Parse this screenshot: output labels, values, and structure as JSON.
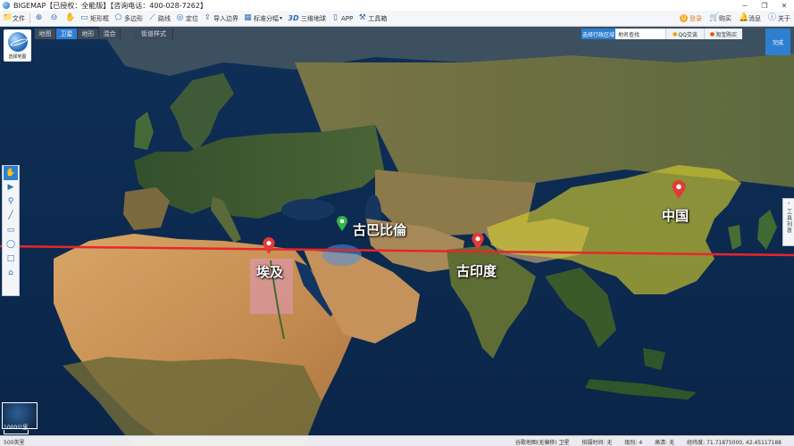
{
  "window": {
    "title": "BIGEMAP【已授权：全能版】【咨询电话：400-028-7262】",
    "controls": [
      "─",
      "❐",
      "✕"
    ]
  },
  "toolbar": {
    "items": [
      {
        "label": "文件",
        "icon": "folder-icon",
        "glyph": "📁"
      },
      {
        "label": "",
        "icon": "zoom-in-icon",
        "glyph": "⊕"
      },
      {
        "label": "",
        "icon": "zoom-out-icon",
        "glyph": "⊖"
      },
      {
        "label": "",
        "icon": "pan-hand-icon",
        "glyph": "✋"
      },
      {
        "label": "矩形框",
        "icon": "rectangle-icon",
        "glyph": "▭"
      },
      {
        "label": "多边形",
        "icon": "polygon-icon",
        "glyph": "⬠"
      },
      {
        "label": "路线",
        "icon": "route-icon",
        "glyph": "⟋"
      },
      {
        "label": "定位",
        "icon": "locate-icon",
        "glyph": "◎"
      },
      {
        "label": "导入边界",
        "icon": "import-boundary-icon",
        "glyph": "⇪"
      },
      {
        "label": "标准分幅",
        "icon": "grid-icon",
        "glyph": "▦"
      },
      {
        "label": "三维地球",
        "icon": "3d-globe-icon",
        "glyph": "3D"
      },
      {
        "label": "APP",
        "icon": "app-icon",
        "glyph": "▯"
      },
      {
        "label": "工具箱",
        "icon": "toolbox-icon",
        "glyph": "⚒"
      }
    ],
    "right": [
      {
        "label": "登录",
        "icon": "user-icon"
      },
      {
        "label": "购买",
        "icon": "cart-icon"
      },
      {
        "label": "消息",
        "icon": "bell-icon"
      },
      {
        "label": "关于",
        "icon": "info-icon"
      }
    ]
  },
  "map_tabs": [
    "地图",
    "卫星",
    "地形",
    "混合"
  ],
  "map_tabs_active": "卫星",
  "street_view_label": "街道样式",
  "logo_caption": "选择地图",
  "search": {
    "region_label": "选择行政区域",
    "placeholder": "地名查找",
    "qq_label": "QQ交谈",
    "buy_label": "淘宝购买"
  },
  "done_label": "完成",
  "right_panel_label": "工具列表",
  "left_tools": [
    {
      "name": "hand-tool-icon",
      "glyph": "✋"
    },
    {
      "name": "pointer-tool-icon",
      "glyph": "▶"
    },
    {
      "name": "marker-tool-icon",
      "glyph": "⚲"
    },
    {
      "name": "line-tool-icon",
      "glyph": "╱"
    },
    {
      "name": "rect-tool-icon",
      "glyph": "▭"
    },
    {
      "name": "circle-tool-icon",
      "glyph": "◯"
    },
    {
      "name": "square-tool-icon",
      "glyph": "□"
    },
    {
      "name": "tag-tool-icon",
      "glyph": "⌂"
    }
  ],
  "places": [
    {
      "name": "古巴比倫",
      "color": "#2fb44a"
    },
    {
      "name": "埃及",
      "color": "#e53935"
    },
    {
      "name": "古印度",
      "color": "#e53935"
    },
    {
      "name": "中国",
      "color": "#e53935"
    }
  ],
  "line_color": "#e8262b",
  "scale": {
    "top": "1000公里",
    "bottom": "500英里"
  },
  "status": {
    "source": "谷歌地图(无偏移) 卫星",
    "shot_time": "拍摄时间: 无",
    "level": "级别: 4",
    "date": "高清: 无",
    "coords": "经纬度: 71.71875000, 42.45117188"
  },
  "colors": {
    "accent": "#2f7fd1",
    "desert": "#c9965a",
    "china_overlay": "#d9d02c"
  }
}
